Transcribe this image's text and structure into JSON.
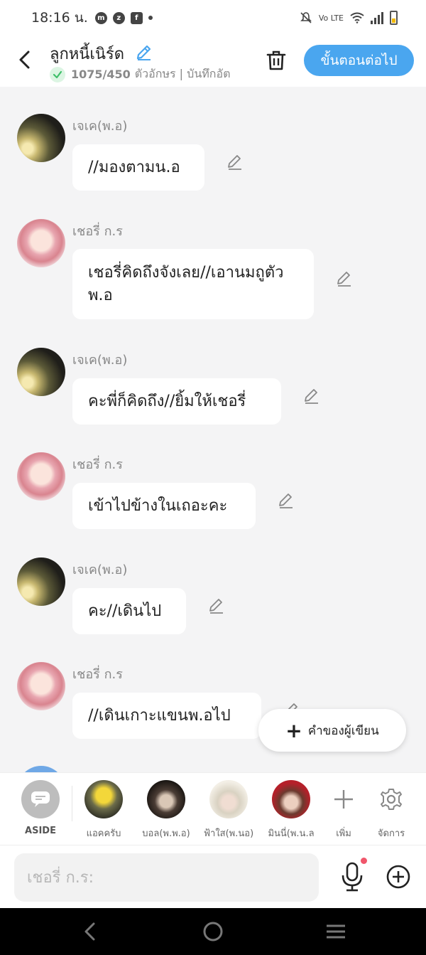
{
  "status_bar": {
    "time": "18:16 น.",
    "network": "Vo LTE"
  },
  "header": {
    "title": "ลูกหนี้เนิร์ด",
    "count": "1075/450",
    "subtitle": "ตัวอักษร | บันทึกอัต",
    "next_label": "ขั้นตอนต่อไป"
  },
  "messages": [
    {
      "sender": "เจเค(พ.อ)",
      "text": "//มองตามน.อ"
    },
    {
      "sender": "เชอรี่ ก.ร",
      "text": "เชอรี่คิดถึงจังเลย//เอานมถูตัวพ.อ"
    },
    {
      "sender": "เจเค(พ.อ)",
      "text": "คะพี่ก็คิดถึง//ยิ้มให้เชอรี่"
    },
    {
      "sender": "เชอรี่ ก.ร",
      "text": "เข้าไปข้างในเถอะคะ"
    },
    {
      "sender": "เจเค(พ.อ)",
      "text": "คะ//เดินไป"
    },
    {
      "sender": "เชอรี่ ก.ร",
      "text": "//เดินเกาะแขนพ.อไป"
    }
  ],
  "fab": {
    "label": "คำของผู้เขียน"
  },
  "cast": [
    {
      "label": "ASIDE"
    },
    {
      "label": "แอคครับ"
    },
    {
      "label": "บอล(พ.พ.อ)"
    },
    {
      "label": "ฟ้าใส(พ.นอ)"
    },
    {
      "label": "มินนี่(พ.น.ล"
    },
    {
      "label": "เพิ่ม"
    },
    {
      "label": "จัดการ"
    }
  ],
  "input": {
    "placeholder": "เชอรี่ ก.ร:"
  },
  "colors": {
    "accent": "#4aa6ef",
    "check": "#3fbf6a",
    "record_dot": "#f0566b"
  },
  "icons": [
    "back-arrow-icon",
    "pencil-icon",
    "check-icon",
    "trash-icon",
    "plus-icon",
    "chat-bubble-icon",
    "gear-icon",
    "mic-icon",
    "add-circle-icon"
  ]
}
